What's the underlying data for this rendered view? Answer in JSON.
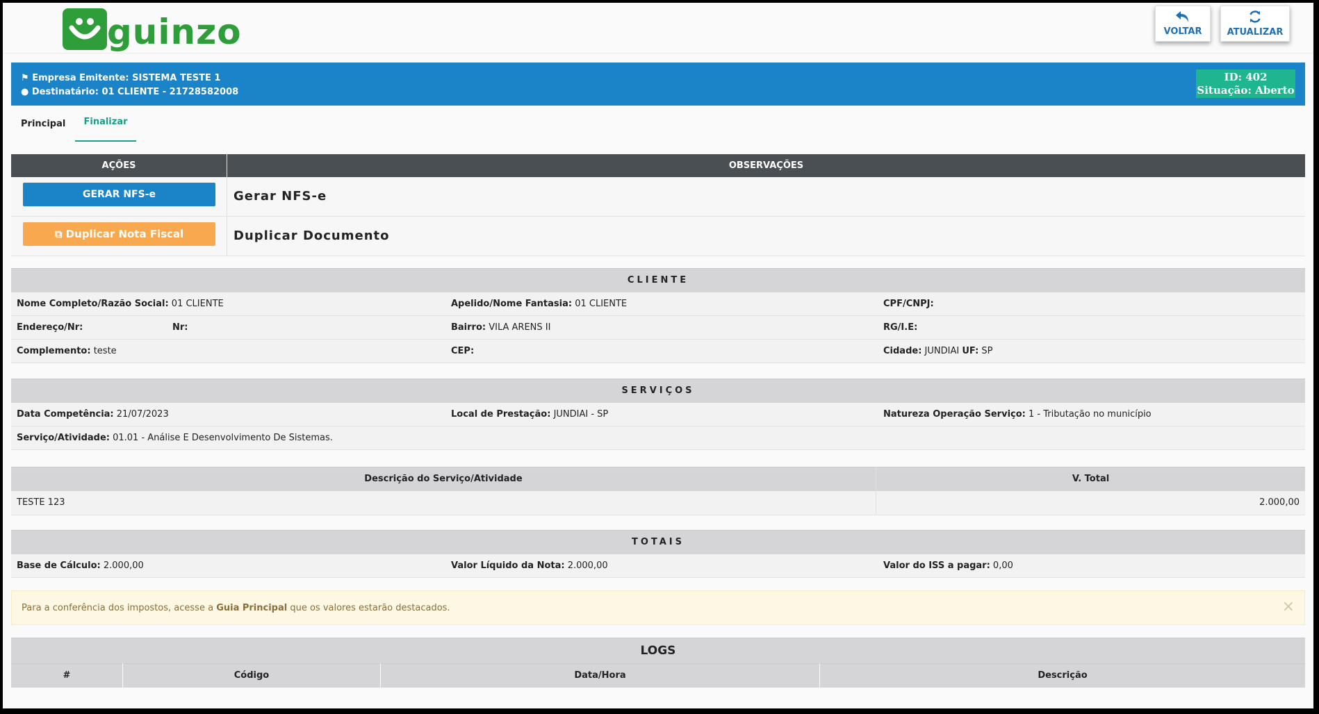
{
  "header": {
    "logo_text": "guinzo",
    "back_label": "VOLTAR",
    "refresh_label": "ATUALIZAR"
  },
  "info": {
    "issuer_label": "Empresa Emitente:",
    "issuer_value": "SISTEMA TESTE 1",
    "recipient_label": "Destinatário:",
    "recipient_value": "01 CLIENTE - 21728582008",
    "id_line": "ID: 402",
    "status_line": "Situação: Aberto"
  },
  "tabs": [
    {
      "label": "Principal"
    },
    {
      "label": "Finalizar"
    }
  ],
  "actions": {
    "col_actions": "AÇÕES",
    "col_obs": "OBSERVAÇÕES",
    "gen_button": "GERAR NFS-e",
    "gen_obs": "Gerar NFS-e",
    "dup_button": "Duplicar Nota Fiscal",
    "dup_obs": "Duplicar Documento"
  },
  "cliente": {
    "title": "CLIENTE",
    "name_label": "Nome Completo/Razão Social:",
    "name_value": "01 CLIENTE",
    "nick_label": "Apelido/Nome Fantasia:",
    "nick_value": "01 CLIENTE",
    "cpf_label": "CPF/CNPJ:",
    "address_label": "Endereço/Nr:",
    "nr_label": "Nr:",
    "bairro_label": "Bairro:",
    "bairro_value": "VILA ARENS II",
    "rg_label": "RG/I.E:",
    "comp_label": "Complemento:",
    "comp_value": "teste",
    "cep_label": "CEP:",
    "cidade_label": "Cidade:",
    "cidade_value": "JUNDIAI",
    "uf_label": "UF:",
    "uf_value": "SP"
  },
  "servicos": {
    "title": "SERVIÇOS",
    "data_label": "Data Competência:",
    "data_value": "21/07/2023",
    "local_label": "Local de Prestação:",
    "local_value": "JUNDIAI - SP",
    "natureza_label": "Natureza Operação Serviço:",
    "natureza_value": "1 - Tributação no município",
    "atividade_label": "Serviço/Atividade:",
    "atividade_value": "01.01 - Análise E Desenvolvimento De Sistemas."
  },
  "items": {
    "col_desc": "Descrição do Serviço/Atividade",
    "col_total": "V. Total",
    "rows": [
      {
        "desc": "TESTE 123",
        "total": "2.000,00"
      }
    ]
  },
  "totais": {
    "title": "TOTAIS",
    "base_label": "Base de Cálculo:",
    "base_value": "2.000,00",
    "liquido_label": "Valor Líquido da Nota:",
    "liquido_value": "2.000,00",
    "iss_label": "Valor do ISS a pagar:",
    "iss_value": "0,00"
  },
  "alert": {
    "text_before": "Para a conferência dos impostos, acesse a ",
    "link": "Guia Principal",
    "text_after": " que os valores estarão destacados.",
    "close": "×"
  },
  "logs": {
    "title": "LOGS",
    "col_num": "#",
    "col_code": "Código",
    "col_date": "Data/Hora",
    "col_desc": "Descrição"
  },
  "colors": {
    "brand_green": "#2e9e3a",
    "primary_blue": "#1b83c8",
    "status_teal": "#1fb58f",
    "warning_orange": "#f8a94f"
  }
}
